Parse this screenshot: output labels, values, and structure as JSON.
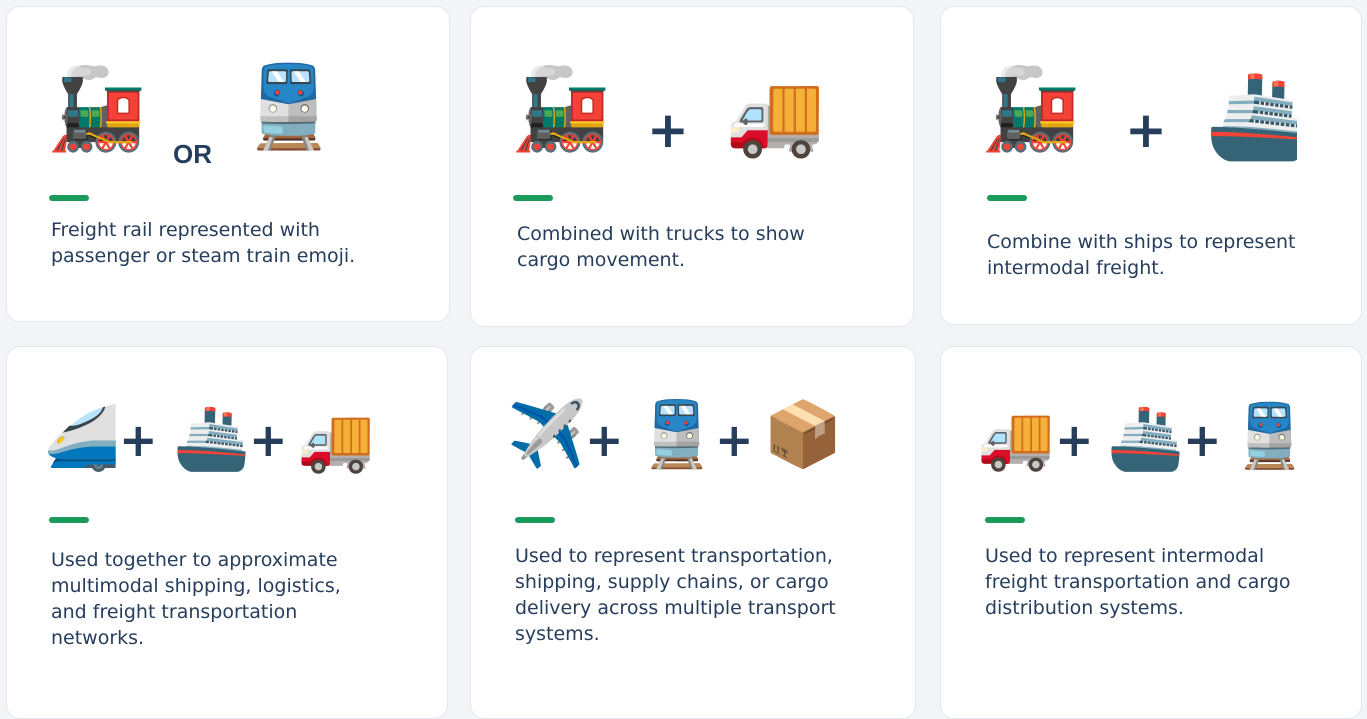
{
  "cards": [
    {
      "icons": [
        {
          "glyph": "🚂",
          "name": "steam-locomotive"
        },
        {
          "glyph": "🚆",
          "name": "train"
        }
      ],
      "separators": [
        "OR"
      ],
      "description": "Freight rail represented with passenger or steam train emoji."
    },
    {
      "icons": [
        {
          "glyph": "🚂",
          "name": "steam-locomotive"
        },
        {
          "glyph": "🚚",
          "name": "delivery-truck"
        }
      ],
      "separators": [
        "+"
      ],
      "description": "Combined with trucks to show cargo movement."
    },
    {
      "icons": [
        {
          "glyph": "🚂",
          "name": "steam-locomotive"
        },
        {
          "glyph": "🚢",
          "name": "ship"
        }
      ],
      "separators": [
        "+"
      ],
      "description": "Combine with ships to represent intermodal freight."
    },
    {
      "icons": [
        {
          "glyph": "🚄",
          "name": "high-speed-train"
        },
        {
          "glyph": "🚢",
          "name": "ship"
        },
        {
          "glyph": "🚚",
          "name": "delivery-truck"
        }
      ],
      "separators": [
        "+",
        "+"
      ],
      "description": "Used together to approximate multimodal shipping, logistics, and freight transportation networks."
    },
    {
      "icons": [
        {
          "glyph": "✈️",
          "name": "airplane"
        },
        {
          "glyph": "🚆",
          "name": "train"
        },
        {
          "glyph": "📦",
          "name": "package"
        }
      ],
      "separators": [
        "+",
        "+"
      ],
      "description": "Used to represent transportation, shipping, supply chains, or cargo delivery across multiple transport systems."
    },
    {
      "icons": [
        {
          "glyph": "🚚",
          "name": "delivery-truck"
        },
        {
          "glyph": "🚢",
          "name": "ship"
        },
        {
          "glyph": "🚆",
          "name": "train"
        }
      ],
      "separators": [
        "+",
        "+"
      ],
      "description": "Used to represent intermodal freight transportation and cargo distribution systems."
    }
  ],
  "colors": {
    "text": "#263d5c",
    "accent": "#1a9a5b",
    "card_bg": "#ffffff",
    "page_bg": "#f2f4f7"
  }
}
